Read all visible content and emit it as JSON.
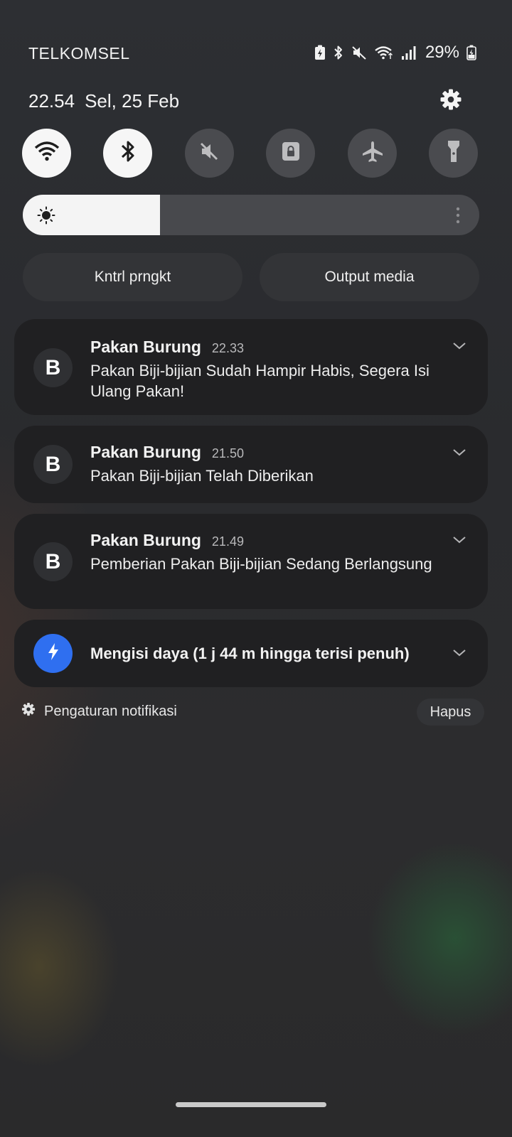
{
  "status_bar": {
    "carrier": "TELKOMSEL",
    "battery_percent": "29%",
    "icons": [
      "battery-saver-icon",
      "bluetooth-icon",
      "mute-icon",
      "wifi-icon",
      "cellular-signal-icon",
      "battery-icon"
    ]
  },
  "header": {
    "time": "22.54",
    "date": "Sel, 25 Feb",
    "settings_icon": "gear-icon"
  },
  "quick_toggles": [
    {
      "name": "wifi",
      "icon": "wifi-icon",
      "state": "on"
    },
    {
      "name": "bluetooth",
      "icon": "bluetooth-icon",
      "state": "on"
    },
    {
      "name": "sound",
      "icon": "mute-icon",
      "state": "off"
    },
    {
      "name": "rotation-lock",
      "icon": "lock-icon",
      "state": "off"
    },
    {
      "name": "airplane",
      "icon": "airplane-icon",
      "state": "off"
    },
    {
      "name": "flashlight",
      "icon": "flashlight-icon",
      "state": "off"
    }
  ],
  "brightness": {
    "level": 0.3,
    "icon": "sun-icon"
  },
  "pills": {
    "device_control": "Kntrl prngkt",
    "media_output": "Output media"
  },
  "notifications": [
    {
      "app_initial": "B",
      "app": "Pakan Burung",
      "time": "22.33",
      "message": "Pakan Biji-bijian Sudah Hampir Habis, Segera Isi Ulang Pakan!"
    },
    {
      "app_initial": "B",
      "app": "Pakan Burung",
      "time": "21.50",
      "message": "Pakan Biji-bijian Telah Diberikan"
    },
    {
      "app_initial": "B",
      "app": "Pakan Burung",
      "time": "21.49",
      "message": "Pemberian Pakan Biji-bijian Sedang Berlangsung"
    }
  ],
  "charging": {
    "text": "Mengisi daya (1 j 44 m hingga terisi penuh)",
    "icon": "lightning-icon"
  },
  "footer": {
    "notif_settings": "Pengaturan notifikasi",
    "clear": "Hapus"
  },
  "colors": {
    "accent_blue": "#2f6ff0",
    "toggle_on": "#f6f6f6",
    "toggle_off": "#4a4b4f",
    "card_bg": "#202022"
  }
}
